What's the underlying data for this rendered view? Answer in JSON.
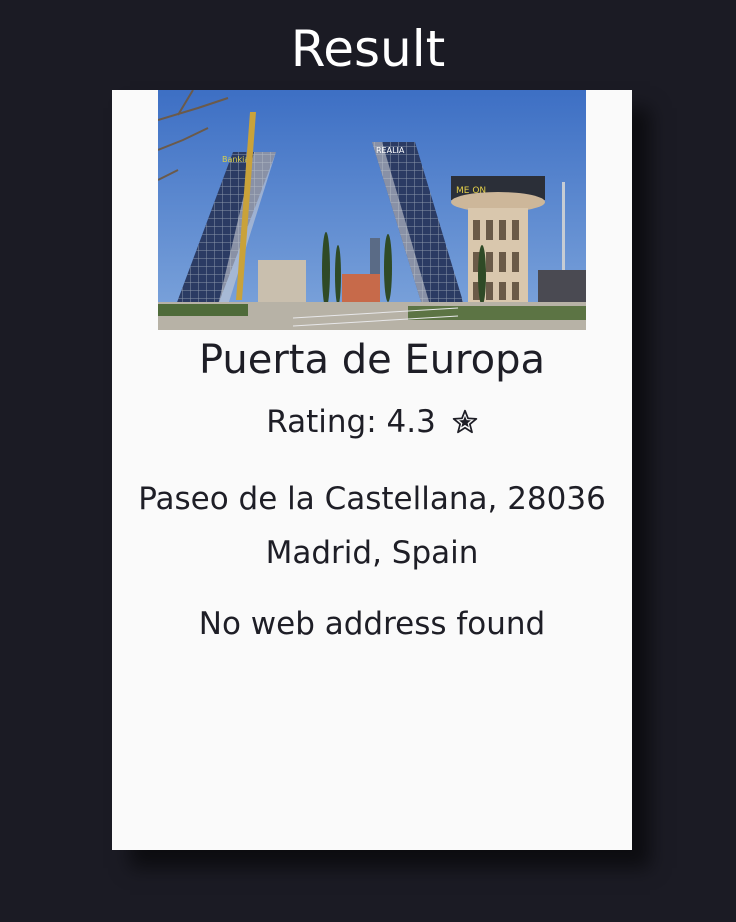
{
  "header": {
    "title": "Result"
  },
  "place": {
    "name": "Puerta de Europa",
    "rating_label": "Rating:",
    "rating_value": "4.3",
    "rating_icon": "star-icon",
    "address_line1": "Paseo de la Castellana, 28036",
    "address_line2": "Madrid, Spain",
    "website": "No web address found",
    "photo_sign_left": "Bankia",
    "photo_sign_right": "REALIA"
  },
  "colors": {
    "background": "#1b1b24",
    "card": "#fafafa",
    "text": "#1e1e26",
    "title": "#ffffff"
  }
}
